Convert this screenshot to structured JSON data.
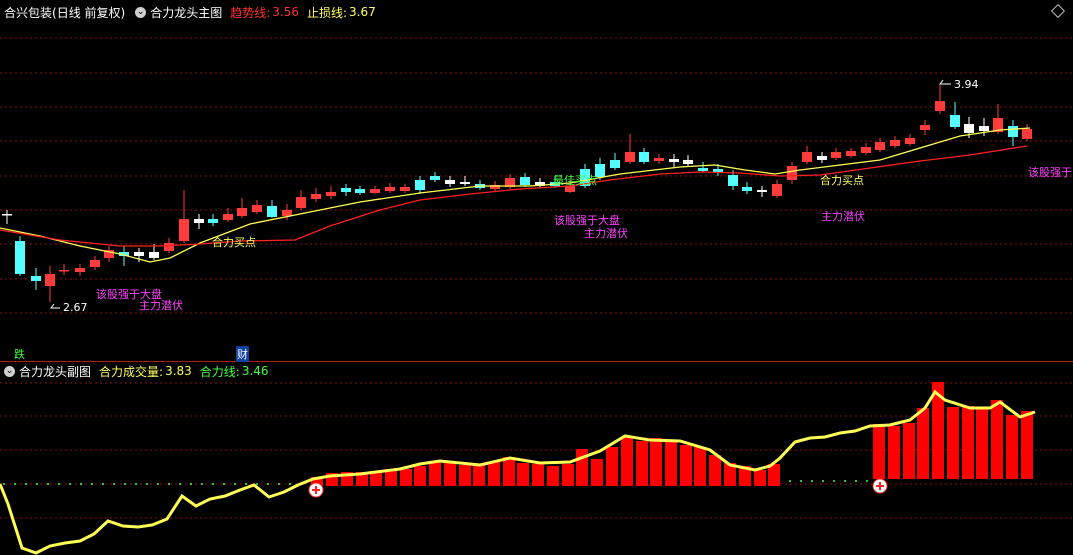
{
  "main_panel": {
    "stock_name": "合兴包装",
    "period": "(日线 前复权)",
    "indicator_name": "合力龙头主图",
    "trend_label": "趋势线:",
    "trend_value": "3.56",
    "stop_label": "止损线:",
    "stop_value": "3.67",
    "high_label": "3.94",
    "low_label": "2.67",
    "annotations": {
      "buy_point_1": "合力买点",
      "buy_point_2": "合力买点",
      "strong_1": "该股强于大盘",
      "strong_2": "该股强于大盘",
      "strong_3": "该股强于",
      "lurk_1": "主力潜伏",
      "lurk_2": "主力潜伏",
      "lurk_3": "主力潜伏",
      "best_buy": "最佳买点"
    },
    "bottom_markers": {
      "fall": "跌",
      "finance": "财"
    }
  },
  "sub_panel": {
    "indicator_name": "合力龙头副图",
    "volume_label": "合力成交量:",
    "volume_value": "3.83",
    "line_label": "合力线:",
    "line_value": "3.46"
  },
  "colors": {
    "up": "#ff3b3b",
    "down": "#54ffff",
    "flat": "#ffffff",
    "trend_line": "#ffff55",
    "stop_line": "#ff2020",
    "magenta": "#ff40ff",
    "label_yellow": "#ffff60",
    "label_green": "#40ff40",
    "grid": "#8b1010"
  },
  "icons": {
    "indicator": "circle-chevron-icon",
    "corner": "diamond-icon",
    "signal": "plus-circle-icon"
  }
}
